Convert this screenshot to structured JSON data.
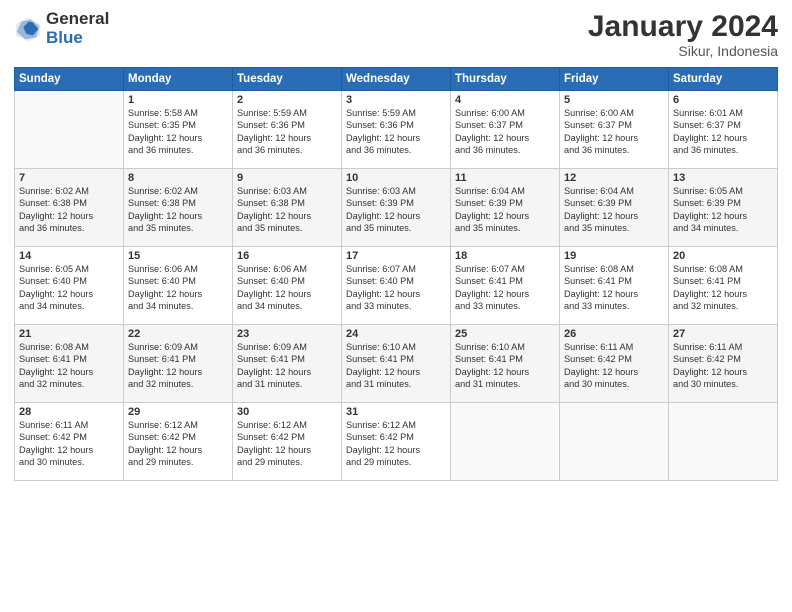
{
  "logo": {
    "general": "General",
    "blue": "Blue"
  },
  "title": "January 2024",
  "location": "Sikur, Indonesia",
  "days_header": [
    "Sunday",
    "Monday",
    "Tuesday",
    "Wednesday",
    "Thursday",
    "Friday",
    "Saturday"
  ],
  "weeks": [
    [
      {
        "day": "",
        "info": ""
      },
      {
        "day": "1",
        "info": "Sunrise: 5:58 AM\nSunset: 6:35 PM\nDaylight: 12 hours\nand 36 minutes."
      },
      {
        "day": "2",
        "info": "Sunrise: 5:59 AM\nSunset: 6:36 PM\nDaylight: 12 hours\nand 36 minutes."
      },
      {
        "day": "3",
        "info": "Sunrise: 5:59 AM\nSunset: 6:36 PM\nDaylight: 12 hours\nand 36 minutes."
      },
      {
        "day": "4",
        "info": "Sunrise: 6:00 AM\nSunset: 6:37 PM\nDaylight: 12 hours\nand 36 minutes."
      },
      {
        "day": "5",
        "info": "Sunrise: 6:00 AM\nSunset: 6:37 PM\nDaylight: 12 hours\nand 36 minutes."
      },
      {
        "day": "6",
        "info": "Sunrise: 6:01 AM\nSunset: 6:37 PM\nDaylight: 12 hours\nand 36 minutes."
      }
    ],
    [
      {
        "day": "7",
        "info": "Sunrise: 6:02 AM\nSunset: 6:38 PM\nDaylight: 12 hours\nand 36 minutes."
      },
      {
        "day": "8",
        "info": "Sunrise: 6:02 AM\nSunset: 6:38 PM\nDaylight: 12 hours\nand 35 minutes."
      },
      {
        "day": "9",
        "info": "Sunrise: 6:03 AM\nSunset: 6:38 PM\nDaylight: 12 hours\nand 35 minutes."
      },
      {
        "day": "10",
        "info": "Sunrise: 6:03 AM\nSunset: 6:39 PM\nDaylight: 12 hours\nand 35 minutes."
      },
      {
        "day": "11",
        "info": "Sunrise: 6:04 AM\nSunset: 6:39 PM\nDaylight: 12 hours\nand 35 minutes."
      },
      {
        "day": "12",
        "info": "Sunrise: 6:04 AM\nSunset: 6:39 PM\nDaylight: 12 hours\nand 35 minutes."
      },
      {
        "day": "13",
        "info": "Sunrise: 6:05 AM\nSunset: 6:39 PM\nDaylight: 12 hours\nand 34 minutes."
      }
    ],
    [
      {
        "day": "14",
        "info": "Sunrise: 6:05 AM\nSunset: 6:40 PM\nDaylight: 12 hours\nand 34 minutes."
      },
      {
        "day": "15",
        "info": "Sunrise: 6:06 AM\nSunset: 6:40 PM\nDaylight: 12 hours\nand 34 minutes."
      },
      {
        "day": "16",
        "info": "Sunrise: 6:06 AM\nSunset: 6:40 PM\nDaylight: 12 hours\nand 34 minutes."
      },
      {
        "day": "17",
        "info": "Sunrise: 6:07 AM\nSunset: 6:40 PM\nDaylight: 12 hours\nand 33 minutes."
      },
      {
        "day": "18",
        "info": "Sunrise: 6:07 AM\nSunset: 6:41 PM\nDaylight: 12 hours\nand 33 minutes."
      },
      {
        "day": "19",
        "info": "Sunrise: 6:08 AM\nSunset: 6:41 PM\nDaylight: 12 hours\nand 33 minutes."
      },
      {
        "day": "20",
        "info": "Sunrise: 6:08 AM\nSunset: 6:41 PM\nDaylight: 12 hours\nand 32 minutes."
      }
    ],
    [
      {
        "day": "21",
        "info": "Sunrise: 6:08 AM\nSunset: 6:41 PM\nDaylight: 12 hours\nand 32 minutes."
      },
      {
        "day": "22",
        "info": "Sunrise: 6:09 AM\nSunset: 6:41 PM\nDaylight: 12 hours\nand 32 minutes."
      },
      {
        "day": "23",
        "info": "Sunrise: 6:09 AM\nSunset: 6:41 PM\nDaylight: 12 hours\nand 31 minutes."
      },
      {
        "day": "24",
        "info": "Sunrise: 6:10 AM\nSunset: 6:41 PM\nDaylight: 12 hours\nand 31 minutes."
      },
      {
        "day": "25",
        "info": "Sunrise: 6:10 AM\nSunset: 6:41 PM\nDaylight: 12 hours\nand 31 minutes."
      },
      {
        "day": "26",
        "info": "Sunrise: 6:11 AM\nSunset: 6:42 PM\nDaylight: 12 hours\nand 30 minutes."
      },
      {
        "day": "27",
        "info": "Sunrise: 6:11 AM\nSunset: 6:42 PM\nDaylight: 12 hours\nand 30 minutes."
      }
    ],
    [
      {
        "day": "28",
        "info": "Sunrise: 6:11 AM\nSunset: 6:42 PM\nDaylight: 12 hours\nand 30 minutes."
      },
      {
        "day": "29",
        "info": "Sunrise: 6:12 AM\nSunset: 6:42 PM\nDaylight: 12 hours\nand 29 minutes."
      },
      {
        "day": "30",
        "info": "Sunrise: 6:12 AM\nSunset: 6:42 PM\nDaylight: 12 hours\nand 29 minutes."
      },
      {
        "day": "31",
        "info": "Sunrise: 6:12 AM\nSunset: 6:42 PM\nDaylight: 12 hours\nand 29 minutes."
      },
      {
        "day": "",
        "info": ""
      },
      {
        "day": "",
        "info": ""
      },
      {
        "day": "",
        "info": ""
      }
    ]
  ]
}
